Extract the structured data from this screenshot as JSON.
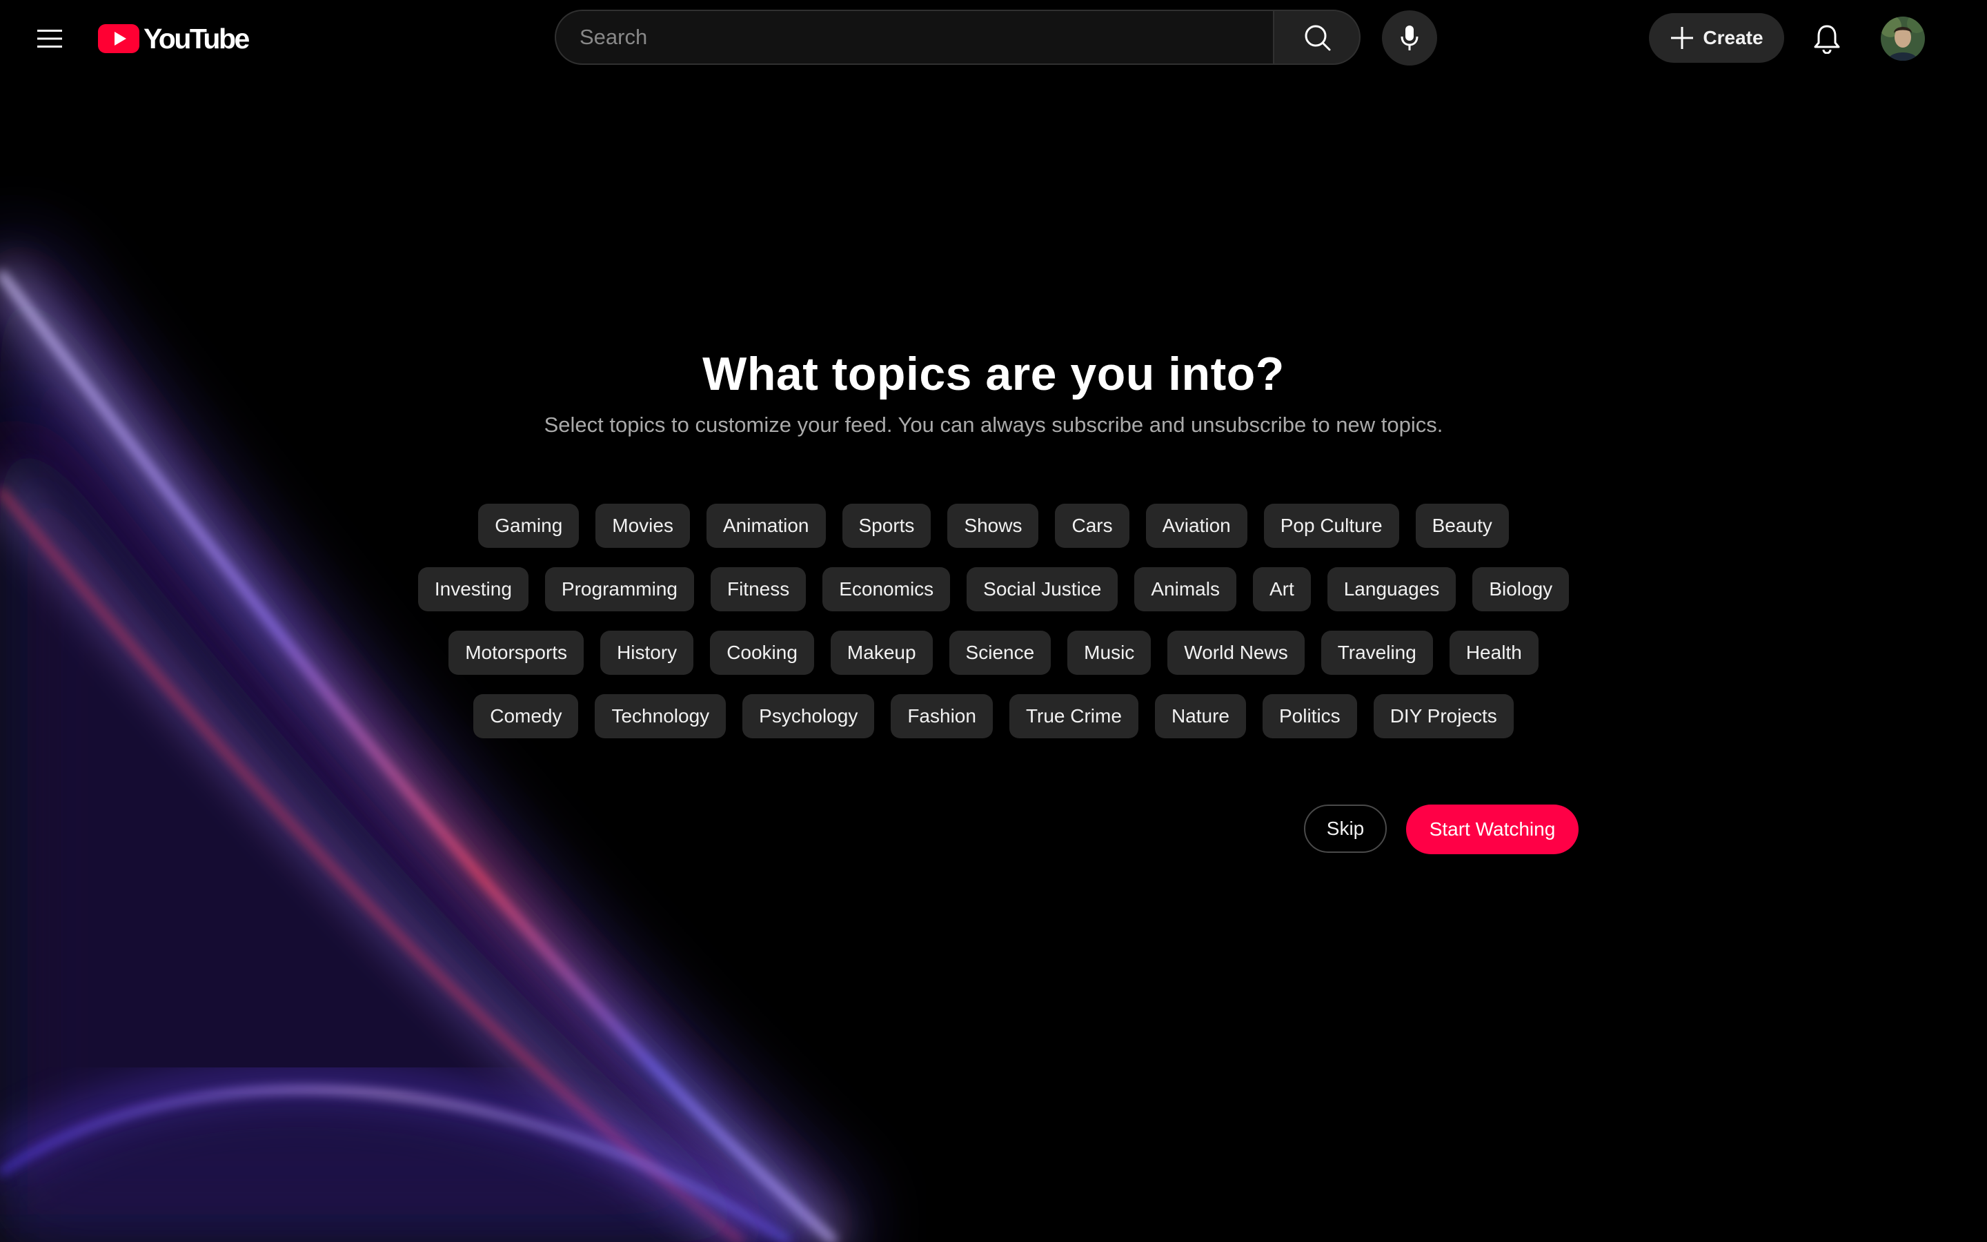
{
  "header": {
    "logo_text": "YouTube",
    "search_placeholder": "Search",
    "create_label": "Create",
    "icons": {
      "menu": "hamburger-menu-icon",
      "search": "search-icon",
      "mic": "microphone-icon",
      "create": "plus-icon",
      "notifications": "bell-icon"
    }
  },
  "main": {
    "title": "What topics are you into?",
    "subtitle": "Select topics to customize your feed. You can always subscribe and unsubscribe to new topics.",
    "topic_rows": [
      [
        "Gaming",
        "Movies",
        "Animation",
        "Sports",
        "Shows",
        "Cars",
        "Aviation",
        "Pop Culture",
        "Beauty"
      ],
      [
        "Investing",
        "Programming",
        "Fitness",
        "Economics",
        "Social Justice",
        "Animals",
        "Art",
        "Languages",
        "Biology"
      ],
      [
        "Motorsports",
        "History",
        "Cooking",
        "Makeup",
        "Science",
        "Music",
        "World News",
        "Traveling",
        "Health"
      ],
      [
        "Comedy",
        "Technology",
        "Psychology",
        "Fashion",
        "True Crime",
        "Nature",
        "Politics",
        "DIY Projects"
      ]
    ],
    "skip_label": "Skip",
    "start_label": "Start Watching"
  },
  "colors": {
    "background": "#000000",
    "chip_bg": "#272727",
    "accent": "#ff0046",
    "logo_red": "#ff0033",
    "subtitle_text": "#aaaaaa"
  }
}
